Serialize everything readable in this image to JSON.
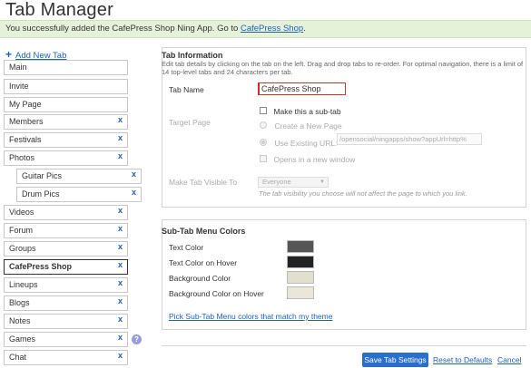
{
  "page": {
    "title": "Tab Manager",
    "notice_text": "You successfully added the CafePress Shop Ning App. Go to ",
    "notice_link": "CafePress Shop",
    "notice_end": "."
  },
  "sidebar": {
    "add_tab_label": "Add New Tab",
    "tabs": [
      {
        "label": "Main",
        "removable": false
      },
      {
        "label": "Invite",
        "removable": false
      },
      {
        "label": "My Page",
        "removable": false
      },
      {
        "label": "Members",
        "removable": true
      },
      {
        "label": "Festivals",
        "removable": true
      },
      {
        "label": "Photos",
        "removable": true
      },
      {
        "label": "Guitar Pics",
        "removable": true,
        "sub": true
      },
      {
        "label": "Drum Pics",
        "removable": true,
        "sub": true
      },
      {
        "label": "Videos",
        "removable": true
      },
      {
        "label": "Forum",
        "removable": true
      },
      {
        "label": "Groups",
        "removable": true
      },
      {
        "label": "CafePress Shop",
        "removable": true,
        "selected": true
      },
      {
        "label": "Lineups",
        "removable": true
      },
      {
        "label": "Blogs",
        "removable": true
      },
      {
        "label": "Notes",
        "removable": true
      },
      {
        "label": "Games",
        "removable": true
      },
      {
        "label": "Chat",
        "removable": true
      }
    ],
    "remove_glyph": "x",
    "help_glyph": "?"
  },
  "tab_info": {
    "heading": "Tab Information",
    "description": "Edit tab details by clicking on the tab on the left. Drag and drop tabs to re-order. For optimal navigation, there is a limit of 14 top-level tabs and 24 characters per tab.",
    "tab_name_label": "Tab Name",
    "tab_name_value": "CafePress Shop",
    "sub_tab_label": "Make this a sub-tab",
    "target_page_label": "Target Page",
    "create_page_label": "Create a New Page",
    "use_existing_label": "Use Existing URL:",
    "existing_url_value": "/opensocial/ningapps/show?appUrl=http%",
    "new_window_label": "Opens in a new window",
    "visible_to_label": "Make Tab Visible To",
    "visible_to_value": "Everyone",
    "visibility_note": "The tab visibility you choose will not affect the page to which you link."
  },
  "sub_tab_colors": {
    "heading": "Sub-Tab Menu Colors",
    "items": [
      {
        "label": "Text Color",
        "color": "#555555"
      },
      {
        "label": "Text Color on Hover",
        "color": "#222222"
      },
      {
        "label": "Background Color",
        "color": "#e3dfcf"
      },
      {
        "label": "Background Color on Hover",
        "color": "#ebe7d8"
      }
    ],
    "match_theme_link": "Pick Sub-Tab Menu colors that match my theme"
  },
  "footer": {
    "save_label": "Save Tab Settings",
    "reset_label": "Reset to Defaults",
    "cancel_label": "Cancel"
  },
  "colors": {
    "link": "#1d5fbf",
    "save_button": "#2a6fd0",
    "notice_bg": "#e6f1d9"
  }
}
